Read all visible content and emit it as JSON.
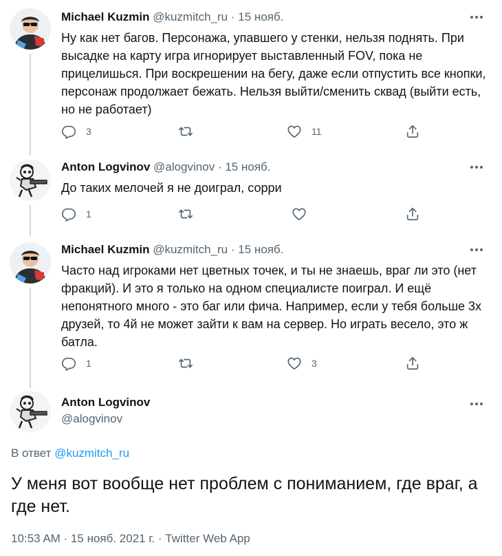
{
  "tweets": [
    {
      "name": "Michael Kuzmin",
      "handle": "@kuzmitch_ru",
      "date": "15 нояб.",
      "text": "Ну как нет багов. Персонажа, упавшего у стенки, нельзя поднять. При высадке на карту игра игнорирует выставленный FOV, пока не прицелишься. При воскрешении на бегу, даже если отпустить все кнопки, персонаж продолжает бежать. Нельзя выйти/сменить сквад (выйти есть, но не работает)",
      "replies": "3",
      "retweets": "",
      "likes": "11"
    },
    {
      "name": "Anton Logvinov",
      "handle": "@alogvinov",
      "date": "15 нояб.",
      "text": "До таких мелочей я не доиграл, сорри",
      "replies": "1",
      "retweets": "",
      "likes": ""
    },
    {
      "name": "Michael Kuzmin",
      "handle": "@kuzmitch_ru",
      "date": "15 нояб.",
      "text": "Часто над игроками нет цветных точек, и ты не знаешь, враг ли это (нет фракций). И это я только на одном специалисте поиграл. И ещё непонятного много - это баг или фича. Например, если у тебя больше 3х друзей, то 4й не может зайти к вам на сервер. Но играть весело, это ж батла.",
      "replies": "1",
      "retweets": "",
      "likes": "3"
    }
  ],
  "main_tweet": {
    "name": "Anton Logvinov",
    "handle": "@alogvinov",
    "reply_label": "В ответ",
    "reply_handle": "@kuzmitch_ru",
    "text": "У меня вот вообще нет проблем с пониманием, где враг, а где нет.",
    "timestamp": "10:53 AM · 15 нояб. 2021 г. · Twitter Web App"
  },
  "sep": "·",
  "colors": {
    "text": "#0f1419",
    "secondary": "#536471",
    "link": "#1d9bf0",
    "thread_line": "#cfd9de"
  },
  "icons": {
    "reply": "reply-icon",
    "retweet": "retweet-icon",
    "like": "heart-icon",
    "share": "share-icon",
    "more": "more-icon"
  }
}
